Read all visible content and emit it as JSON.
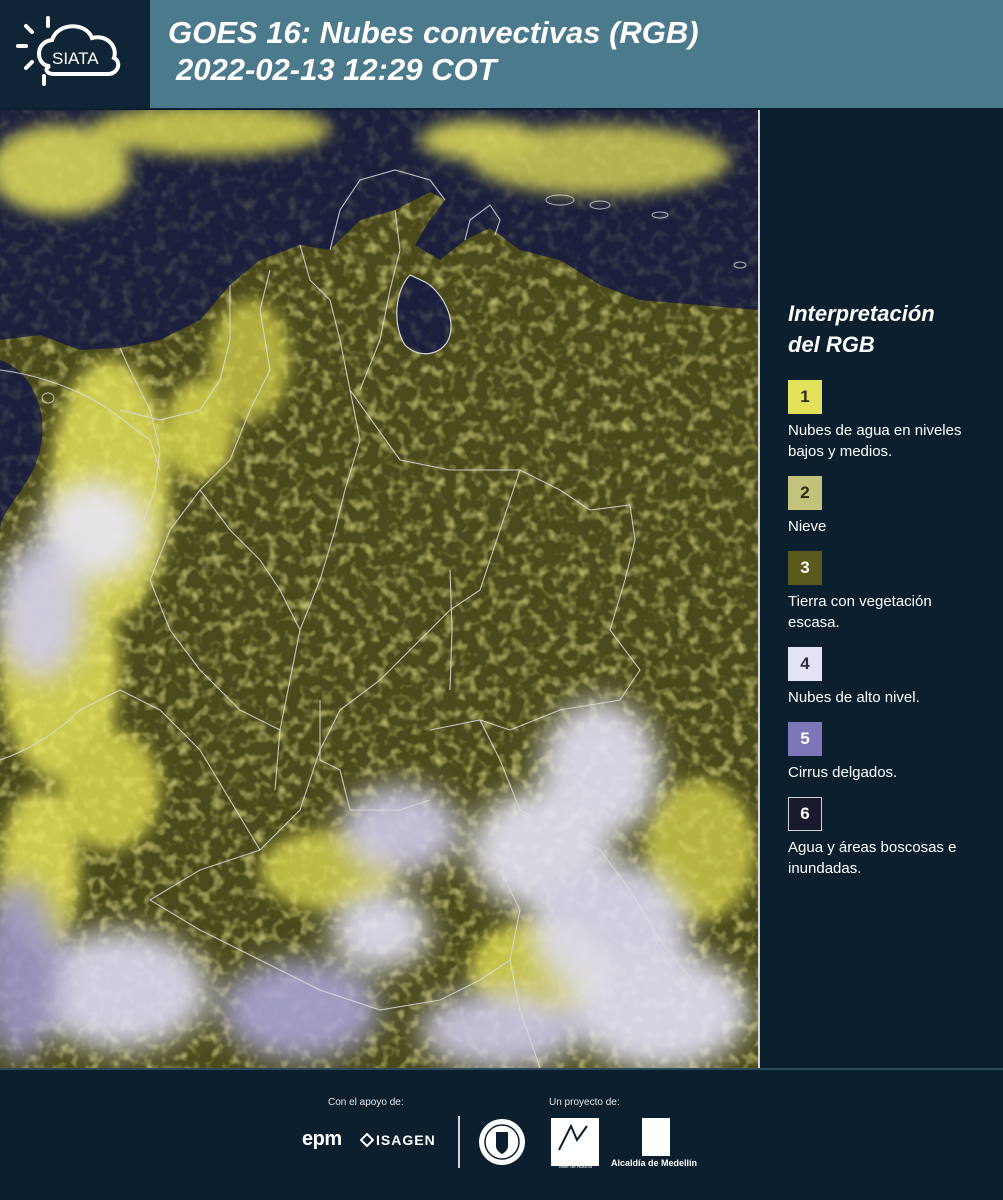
{
  "header": {
    "logo_text": "SIATA",
    "title_line1": "GOES 16: Nubes convectivas (RGB)",
    "title_line2": "2022-02-13 12:29 COT",
    "background_color": "#4b7a8c"
  },
  "legend": {
    "title_line1": "Interpretación",
    "title_line2": "del RGB",
    "items": [
      {
        "number": "1",
        "label": "Nubes de agua en niveles bajos y medios.",
        "color": "#e3e05a",
        "text_color": "#2a2a10"
      },
      {
        "number": "2",
        "label": "Nieve",
        "color": "#c3c27a",
        "text_color": "#2a2a10"
      },
      {
        "number": "3",
        "label": "Tierra con vegetación escasa.",
        "color": "#5a5a1e",
        "text_color": "#ffffff"
      },
      {
        "number": "4",
        "label": "Nubes de alto nivel.",
        "color": "#e4e2f6",
        "text_color": "#2a2a40"
      },
      {
        "number": "5",
        "label": "Cirrus delgados.",
        "color": "#7c78b8",
        "text_color": "#ffffff"
      },
      {
        "number": "6",
        "label": "Agua y áreas boscosas e inundadas.",
        "color": "#1a1a2e",
        "text_color": "#ffffff"
      }
    ]
  },
  "footer": {
    "support_label": "Con el apoyo de:",
    "project_label": "Un proyecto de:",
    "sponsor_1": "epm",
    "sponsor_2": "ISAGEN",
    "partner_metro_1": "METROPOLITANA",
    "partner_metro_2": "Valle de Aburrá",
    "partner_alcaldia": "Alcaldía de Medellín"
  },
  "map": {
    "icon": "satellite-rgb-map",
    "colors": {
      "ocean": "#1a1e3a",
      "land": "#4a4a1c",
      "low_clouds": "#e3e05a",
      "high_clouds": "#e4e2f6",
      "border": "#dcdcdc"
    }
  }
}
